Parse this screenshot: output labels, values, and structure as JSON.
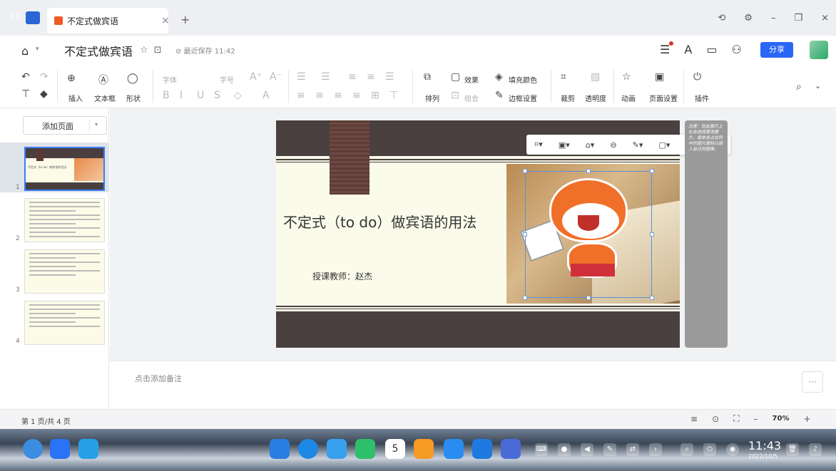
{
  "tabbar": {
    "corner_number": "13",
    "tab_title": "不定式做宾语",
    "close_glyph": "×",
    "add_glyph": "+",
    "window_controls": [
      "⟲",
      "⚙",
      "–",
      "❐",
      "×"
    ]
  },
  "titlebar": {
    "doc_title": "不定式做宾语",
    "save_status": "⊘ 最近保存 11:42",
    "share_label": "分享"
  },
  "ribbon": {
    "row1": {
      "font_placeholder": "字体",
      "size_placeholder": "字号",
      "effect": "效果",
      "fill_color": "填充颜色"
    },
    "row2": {
      "insert": "插入",
      "textbox": "文本框",
      "shape": "形状",
      "arrange": "排列",
      "group": "组合",
      "border": "边框设置",
      "crop": "裁剪",
      "transparency": "透明度",
      "animation": "动画",
      "page_setup": "页面设置",
      "plugin": "插件"
    }
  },
  "left_panel": {
    "add_page": "添加页面",
    "thumbnails": [
      {
        "num": "1",
        "caption": "不定式（to do）做宾语的用法"
      },
      {
        "num": "2"
      },
      {
        "num": "3"
      },
      {
        "num": "4"
      }
    ]
  },
  "slide": {
    "title": "不定式（to do）做宾语的用法",
    "teacher": "授课教师：赵杰",
    "side_note": "注意：在此图片上右击选择更改图片，或单击占位符中的图片图标以插入自己的图像。"
  },
  "notes": {
    "placeholder": "点击添加备注",
    "more": "···"
  },
  "status": {
    "page_info": "第 1 页/共 4 页",
    "zoom": "70%",
    "minus": "–",
    "plus": "+"
  },
  "taskbar": {
    "time": "11:43",
    "date": "2022/10/5",
    "calendar_day": "5"
  },
  "colors": {
    "accent": "#2a66f6",
    "slide_band": "#4a4040",
    "slide_bg": "#fbfbeb",
    "cat": "#f0702a"
  }
}
